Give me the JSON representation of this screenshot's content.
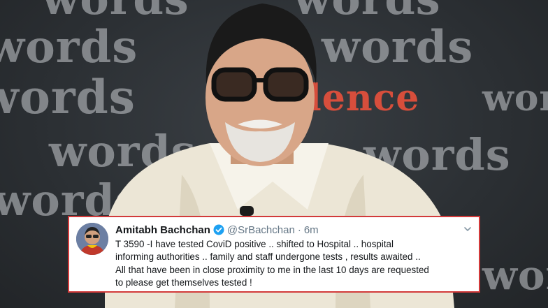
{
  "background": {
    "words": [
      "words",
      "words",
      "words",
      "words",
      "words",
      "words",
      "words",
      "words",
      "words",
      "words"
    ],
    "highlight_word": "lence",
    "accent_color": "#e0503c"
  },
  "tweet": {
    "author_name": "Amitabh Bachchan",
    "verified_icon": "verified-badge-icon",
    "handle": "@SrBachchan",
    "separator": "·",
    "time_ago": "6m",
    "menu_icon": "chevron-down-icon",
    "text_lines": [
      "T 3590 -I have tested CoviD positive ..  shifted to Hospital  .. hospital",
      "informing  authorities .. family and staff undergone tests , results awaited ..",
      "All that have been in close proximity to me in the last 10 days are requested",
      "to please get themselves tested !"
    ],
    "border_color": "#d23a3a",
    "verified_color": "#1da1f2"
  }
}
